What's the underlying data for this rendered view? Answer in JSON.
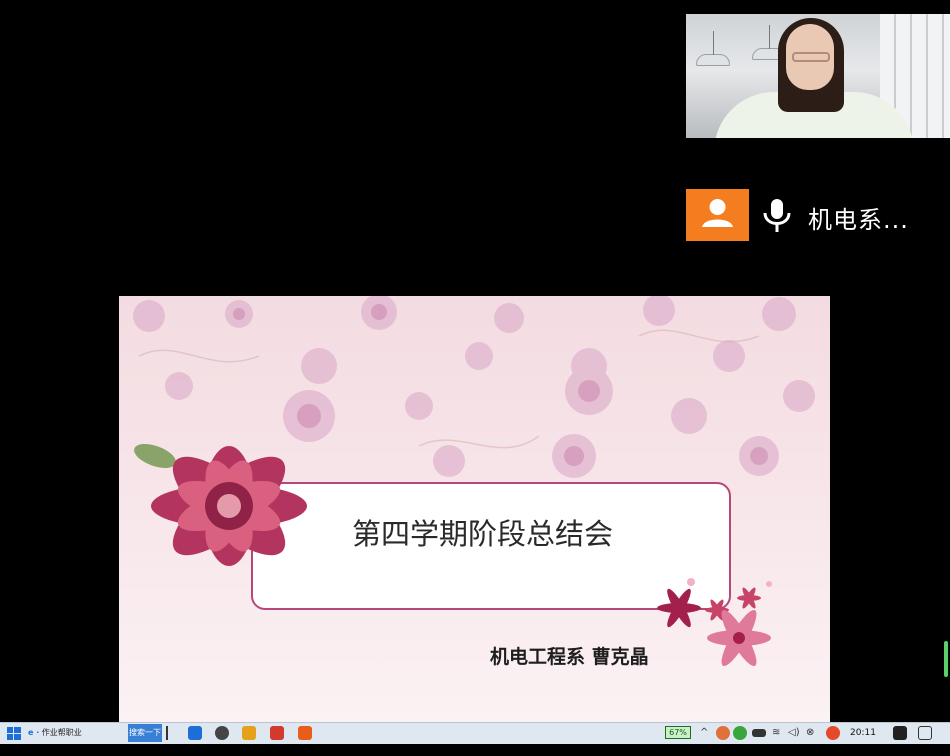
{
  "participant": {
    "name": "机电系...",
    "avatar_icon": "person-icon",
    "mic_icon": "microphone-icon"
  },
  "camera": {
    "alt": "self-view-video"
  },
  "slide": {
    "title": "第四学期阶段总结会",
    "author": "机电工程系   曹克晶"
  },
  "taskbar": {
    "ie_label": "作业帮职业",
    "search_label": "搜索一下",
    "battery_label": "67%",
    "clock": "20:11",
    "colors": {
      "accent": "#3a7fd6",
      "orange": "#f47d1f",
      "frame": "#b7477a"
    }
  }
}
